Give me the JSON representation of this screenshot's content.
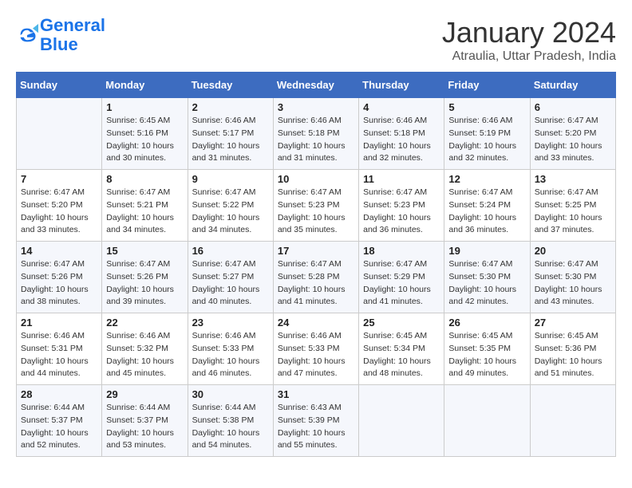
{
  "header": {
    "logo_line1": "General",
    "logo_line2": "Blue",
    "month_title": "January 2024",
    "location": "Atraulia, Uttar Pradesh, India"
  },
  "days_of_week": [
    "Sunday",
    "Monday",
    "Tuesday",
    "Wednesday",
    "Thursday",
    "Friday",
    "Saturday"
  ],
  "weeks": [
    [
      {
        "day": "",
        "info": ""
      },
      {
        "day": "1",
        "info": "Sunrise: 6:45 AM\nSunset: 5:16 PM\nDaylight: 10 hours\nand 30 minutes."
      },
      {
        "day": "2",
        "info": "Sunrise: 6:46 AM\nSunset: 5:17 PM\nDaylight: 10 hours\nand 31 minutes."
      },
      {
        "day": "3",
        "info": "Sunrise: 6:46 AM\nSunset: 5:18 PM\nDaylight: 10 hours\nand 31 minutes."
      },
      {
        "day": "4",
        "info": "Sunrise: 6:46 AM\nSunset: 5:18 PM\nDaylight: 10 hours\nand 32 minutes."
      },
      {
        "day": "5",
        "info": "Sunrise: 6:46 AM\nSunset: 5:19 PM\nDaylight: 10 hours\nand 32 minutes."
      },
      {
        "day": "6",
        "info": "Sunrise: 6:47 AM\nSunset: 5:20 PM\nDaylight: 10 hours\nand 33 minutes."
      }
    ],
    [
      {
        "day": "7",
        "info": "Sunrise: 6:47 AM\nSunset: 5:20 PM\nDaylight: 10 hours\nand 33 minutes."
      },
      {
        "day": "8",
        "info": "Sunrise: 6:47 AM\nSunset: 5:21 PM\nDaylight: 10 hours\nand 34 minutes."
      },
      {
        "day": "9",
        "info": "Sunrise: 6:47 AM\nSunset: 5:22 PM\nDaylight: 10 hours\nand 34 minutes."
      },
      {
        "day": "10",
        "info": "Sunrise: 6:47 AM\nSunset: 5:23 PM\nDaylight: 10 hours\nand 35 minutes."
      },
      {
        "day": "11",
        "info": "Sunrise: 6:47 AM\nSunset: 5:23 PM\nDaylight: 10 hours\nand 36 minutes."
      },
      {
        "day": "12",
        "info": "Sunrise: 6:47 AM\nSunset: 5:24 PM\nDaylight: 10 hours\nand 36 minutes."
      },
      {
        "day": "13",
        "info": "Sunrise: 6:47 AM\nSunset: 5:25 PM\nDaylight: 10 hours\nand 37 minutes."
      }
    ],
    [
      {
        "day": "14",
        "info": "Sunrise: 6:47 AM\nSunset: 5:26 PM\nDaylight: 10 hours\nand 38 minutes."
      },
      {
        "day": "15",
        "info": "Sunrise: 6:47 AM\nSunset: 5:26 PM\nDaylight: 10 hours\nand 39 minutes."
      },
      {
        "day": "16",
        "info": "Sunrise: 6:47 AM\nSunset: 5:27 PM\nDaylight: 10 hours\nand 40 minutes."
      },
      {
        "day": "17",
        "info": "Sunrise: 6:47 AM\nSunset: 5:28 PM\nDaylight: 10 hours\nand 41 minutes."
      },
      {
        "day": "18",
        "info": "Sunrise: 6:47 AM\nSunset: 5:29 PM\nDaylight: 10 hours\nand 41 minutes."
      },
      {
        "day": "19",
        "info": "Sunrise: 6:47 AM\nSunset: 5:30 PM\nDaylight: 10 hours\nand 42 minutes."
      },
      {
        "day": "20",
        "info": "Sunrise: 6:47 AM\nSunset: 5:30 PM\nDaylight: 10 hours\nand 43 minutes."
      }
    ],
    [
      {
        "day": "21",
        "info": "Sunrise: 6:46 AM\nSunset: 5:31 PM\nDaylight: 10 hours\nand 44 minutes."
      },
      {
        "day": "22",
        "info": "Sunrise: 6:46 AM\nSunset: 5:32 PM\nDaylight: 10 hours\nand 45 minutes."
      },
      {
        "day": "23",
        "info": "Sunrise: 6:46 AM\nSunset: 5:33 PM\nDaylight: 10 hours\nand 46 minutes."
      },
      {
        "day": "24",
        "info": "Sunrise: 6:46 AM\nSunset: 5:33 PM\nDaylight: 10 hours\nand 47 minutes."
      },
      {
        "day": "25",
        "info": "Sunrise: 6:45 AM\nSunset: 5:34 PM\nDaylight: 10 hours\nand 48 minutes."
      },
      {
        "day": "26",
        "info": "Sunrise: 6:45 AM\nSunset: 5:35 PM\nDaylight: 10 hours\nand 49 minutes."
      },
      {
        "day": "27",
        "info": "Sunrise: 6:45 AM\nSunset: 5:36 PM\nDaylight: 10 hours\nand 51 minutes."
      }
    ],
    [
      {
        "day": "28",
        "info": "Sunrise: 6:44 AM\nSunset: 5:37 PM\nDaylight: 10 hours\nand 52 minutes."
      },
      {
        "day": "29",
        "info": "Sunrise: 6:44 AM\nSunset: 5:37 PM\nDaylight: 10 hours\nand 53 minutes."
      },
      {
        "day": "30",
        "info": "Sunrise: 6:44 AM\nSunset: 5:38 PM\nDaylight: 10 hours\nand 54 minutes."
      },
      {
        "day": "31",
        "info": "Sunrise: 6:43 AM\nSunset: 5:39 PM\nDaylight: 10 hours\nand 55 minutes."
      },
      {
        "day": "",
        "info": ""
      },
      {
        "day": "",
        "info": ""
      },
      {
        "day": "",
        "info": ""
      }
    ]
  ]
}
